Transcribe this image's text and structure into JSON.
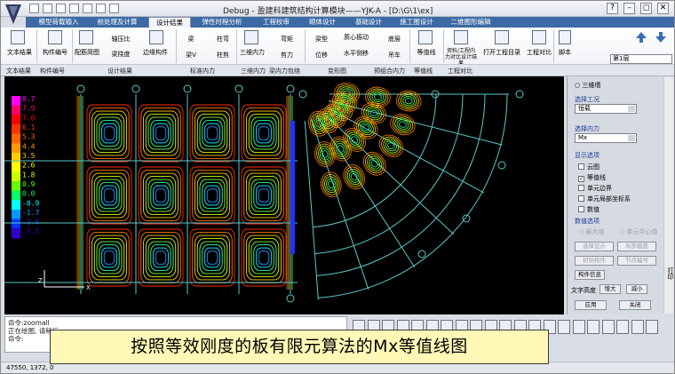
{
  "window": {
    "title": "Debug - 盈建科建筑结构计算模块——YJK-A - [D:\\G\\1\\ex]",
    "min": "–",
    "restore": "◻",
    "close": "✕",
    "help": "?"
  },
  "tabs": [
    "模型荷载输入",
    "前处理及计算",
    "设计结果",
    "弹性时程分析",
    "工程校审",
    "砌体设计",
    "基础设计",
    "施工图设计",
    "二维图形编辑"
  ],
  "active_tab": "设计结果",
  "ribbon": {
    "buttons": [
      "文本结果",
      "构件编号",
      "配筋简图",
      "轴压比",
      "梁挠度",
      "边缘构件",
      "梁",
      "梁V",
      "柱弯",
      "柱剪",
      "三维内力",
      "弯矩",
      "剪力",
      "梁型",
      "位移",
      "质心振动",
      "水平侧移",
      "底层",
      "吊车",
      "等值线",
      "资料/工程内力对比设计结果",
      "打开工程目录",
      "工程对比",
      "脚本"
    ],
    "groups": [
      "文本结果",
      "构件编号",
      "设计结果",
      "标准内力",
      "三维内力",
      "梁内力包络",
      "变形图",
      "预组合内力",
      "等值线",
      "工程对比"
    ],
    "floor": "第1层"
  },
  "legend": [
    "8.7",
    "7.9",
    "7.0",
    "6.1",
    "5.3",
    "4.4",
    "3.5",
    "2.6",
    "1.8",
    "0.9",
    "0.0",
    "-0.9",
    "-1.7",
    "-2.6",
    "-3.5"
  ],
  "legend_colors": [
    "#ff00ff",
    "#ff0066",
    "#ff0000",
    "#ff3300",
    "#ff6600",
    "#ff9900",
    "#ffcc00",
    "#ffff00",
    "#ccff00",
    "#66ff00",
    "#00ff66",
    "#00ffff",
    "#0099ff",
    "#0033ff",
    "#3300cc"
  ],
  "panel": {
    "view_label": "三维墙",
    "case_title": "选择工况",
    "case_value": "恒载",
    "force_title": "选择内力",
    "force_value": "Mx",
    "display_title": "显示选项",
    "options": [
      {
        "label": "云图",
        "checked": false
      },
      {
        "label": "等值线",
        "checked": true
      },
      {
        "label": "单元边界",
        "checked": false
      },
      {
        "label": "单元局部坐标系",
        "checked": false
      },
      {
        "label": "数值",
        "checked": false
      }
    ],
    "value_title": "数值选项",
    "value_opts": [
      "最大值",
      "单元中心值"
    ],
    "btns": [
      "选择显示",
      "局部截面",
      "初始构件",
      "节点编号",
      "构件信息"
    ],
    "text_height_label": "文字高度",
    "zoom_in": "增大",
    "zoom_out": "减小",
    "apply": "应用",
    "close": "关闭"
  },
  "command": {
    "lines": [
      "命令:zoomall",
      "正在绘图, 请稍后",
      "命令:"
    ]
  },
  "status": "47550, 1372, 0",
  "caption": "按照等效刚度的板有限元算法的Mx等值线图",
  "side_label": "打印"
}
